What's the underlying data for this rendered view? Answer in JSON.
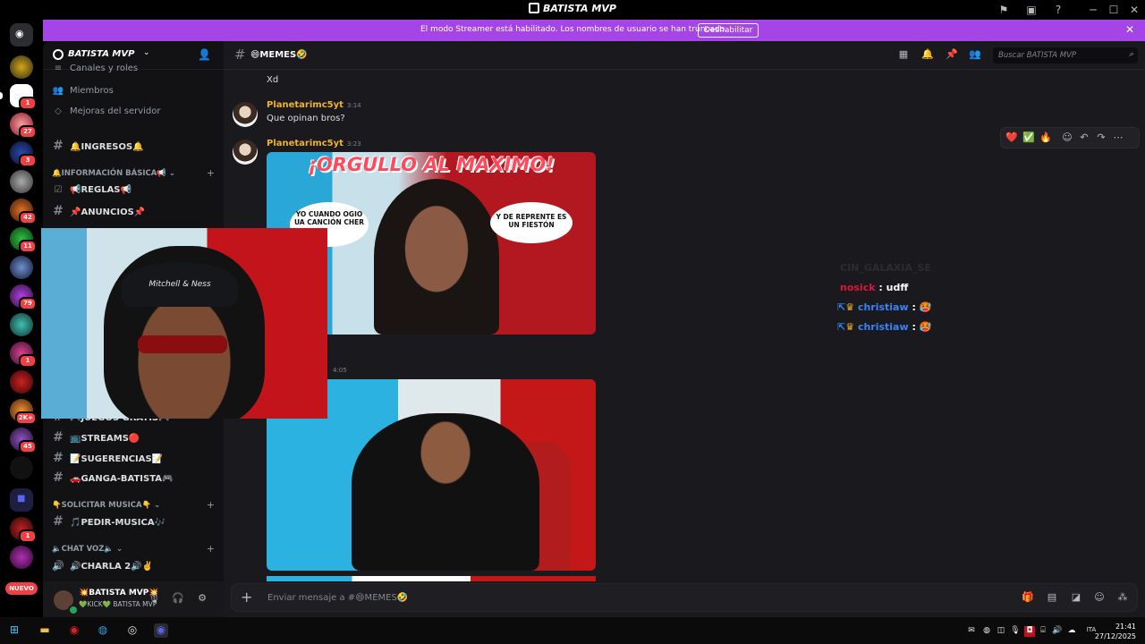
{
  "window": {
    "title": "BATISTA MVP",
    "controls": {
      "minimize": "─",
      "maximize": "☐",
      "close": "✕"
    },
    "toolbar_icons": [
      "flag-icon",
      "inbox-icon",
      "help-icon"
    ]
  },
  "banner": {
    "text": "El modo Streamer está habilitado. Los nombres de usuario se han truncado.",
    "button": "Deshabilitar",
    "close": "✕"
  },
  "rail": {
    "badges": [
      "1",
      "27",
      "3",
      "42",
      "11",
      "79",
      "1",
      "2K+",
      "45",
      "1"
    ],
    "new_label": "NUEVO"
  },
  "sidebar": {
    "server_name": "BATISTA MVP",
    "top_items": [
      "Canales y roles",
      "Miembros",
      "Mejoras del servidor"
    ],
    "channels": [
      {
        "name": "🔔INGRESOS🔔"
      },
      {
        "category": "🔔INFORMACIÓN BÁSICA📢"
      },
      {
        "name": "📢REGLAS📢"
      },
      {
        "name": "📌ANUNCIOS📌"
      },
      {
        "name": "🎮JUEGOS GRATIS🎮"
      },
      {
        "name": "📺STREAMS🔴"
      },
      {
        "name": "📝SUGERENCIAS📝"
      },
      {
        "name": "🚗GANGA-BATISTA🎮"
      },
      {
        "category": "👇SOLICITAR MUSICA👇"
      },
      {
        "name": "🎵PEDIR-MUSICA🎶"
      },
      {
        "category": "🔈CHAT VOZ🔈"
      },
      {
        "name": "🔊CHARLA 2🔊✌️"
      }
    ],
    "user": {
      "name": "💥BATISTA MVP💥",
      "status": "💚KICK💚 BATISTA MVP"
    }
  },
  "channel": {
    "name": "😄MEMES🤣",
    "search_placeholder": "Buscar BATISTA MVP",
    "header_icons": [
      "threads-icon",
      "bell-icon",
      "pin-icon",
      "members-icon"
    ]
  },
  "messages": [
    {
      "text": "Xd"
    },
    {
      "author": "Planetarimc5yt",
      "time": "3:14",
      "text": "Que opinan bros?"
    },
    {
      "author": "Planetarimc5yt",
      "time": "3:23",
      "image": {
        "caption": "¡ORGULLO AL MAXIMO!",
        "bubble_left": "YO CUANDO OGIO UA CANCIÓN CHER",
        "bubble_right": "Y DE REPRENTE ES UN FIESTÓN"
      }
    },
    {
      "time": "4:05"
    }
  ],
  "reactions": [
    "❤️",
    "✅",
    "🔥"
  ],
  "overlay_chat": [
    {
      "user": "nosick",
      "text": ": udff",
      "color": "#e0153b"
    },
    {
      "user": "christiaw",
      "text": ":",
      "color": "#3b82f6"
    },
    {
      "user": "christiaw",
      "text": ":",
      "color": "#3b82f6"
    }
  ],
  "overlay_faint": "CIN_GALAXIA_SE",
  "webcam": {
    "cap_text": "Mitchell & Ness"
  },
  "input": {
    "placeholder": "Enviar mensaje a #😄MEMES🤣"
  },
  "taskbar": {
    "time": "21:41",
    "date": "27/12/2025",
    "lang": "ITA"
  }
}
